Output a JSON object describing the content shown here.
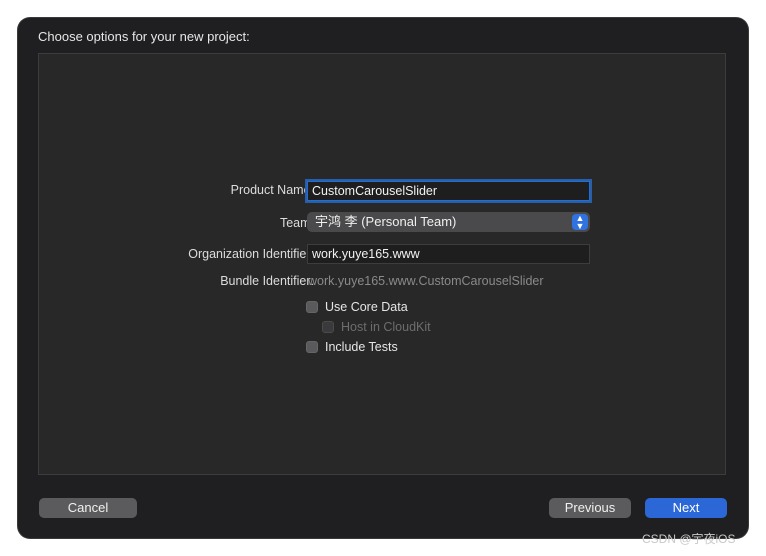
{
  "dialog": {
    "title": "Choose options for your new project:"
  },
  "form": {
    "product_name": {
      "label": "Product Name:",
      "value": "CustomCarouselSlider"
    },
    "team": {
      "label": "Team:",
      "value": "宇鸿 李 (Personal Team)"
    },
    "organization_identifier": {
      "label": "Organization Identifier:",
      "value": "work.yuye165.www"
    },
    "bundle_identifier": {
      "label": "Bundle Identifier:",
      "value": "work.yuye165.www.CustomCarouselSlider"
    },
    "use_core_data": {
      "label": "Use Core Data",
      "checked": false
    },
    "host_in_cloudkit": {
      "label": "Host in CloudKit",
      "checked": false,
      "enabled": false
    },
    "include_tests": {
      "label": "Include Tests",
      "checked": false
    }
  },
  "buttons": {
    "cancel": "Cancel",
    "previous": "Previous",
    "next": "Next"
  },
  "watermark": "CSDN @宇夜iOS",
  "colors": {
    "accent": "#2b67d6",
    "window_bg": "#1f1f21",
    "panel_bg": "#282828"
  }
}
